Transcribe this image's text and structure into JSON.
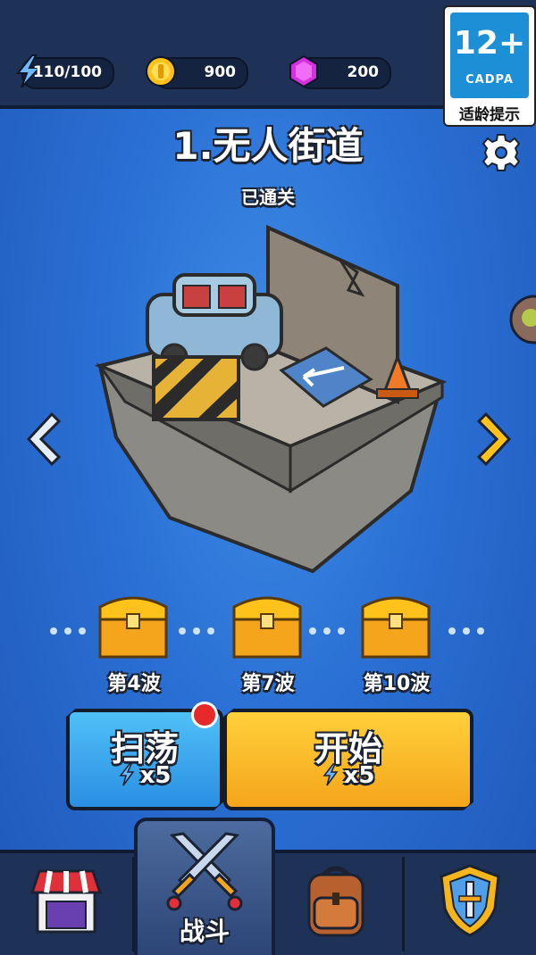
{
  "resources": {
    "energy": "110/100",
    "coins": "900",
    "gems": "200"
  },
  "age_rating": {
    "number": "12+",
    "org": "CADPA",
    "tip": "适龄提示"
  },
  "level": {
    "title": "1.无人街道",
    "status": "已通关"
  },
  "rewards": [
    {
      "label": "第4波"
    },
    {
      "label": "第7波"
    },
    {
      "label": "第10波"
    }
  ],
  "buttons": {
    "sweep_label": "扫荡",
    "sweep_cost": "x5",
    "start_label": "开始",
    "start_cost": "x5"
  },
  "nav": {
    "battle_label": "战斗",
    "active": "battle"
  },
  "colors": {
    "background": "#2a6fd4",
    "topbar": "#1e3157",
    "start_button": "#f5a51b",
    "sweep_button": "#2a8fe3",
    "notification": "#e62a2a"
  },
  "icons": [
    "energy-bolt-icon",
    "coin-icon",
    "gem-icon",
    "gear-icon",
    "arrow-left-icon",
    "arrow-right-icon",
    "chest-icon",
    "shop-icon",
    "swords-icon",
    "backpack-icon",
    "shield-icon"
  ]
}
